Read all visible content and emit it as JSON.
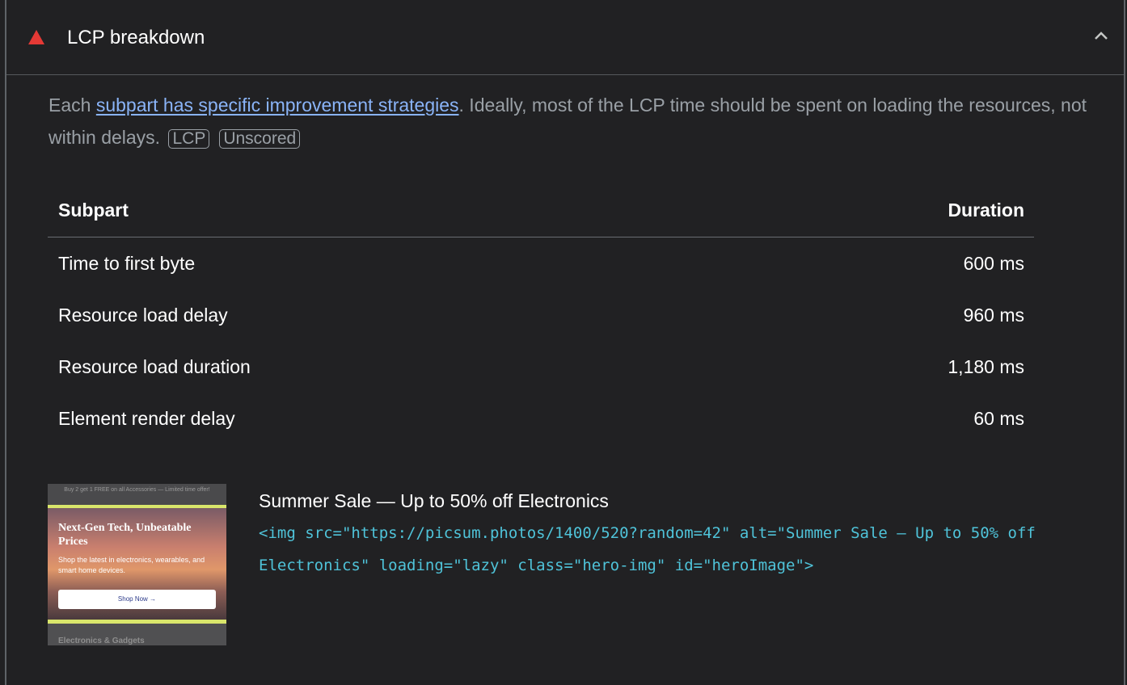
{
  "header": {
    "title": "LCP breakdown",
    "icon": "warning-triangle-icon",
    "chevron_icon": "chevron-up-icon",
    "warning_color": "#e53935"
  },
  "description": {
    "prefix": "Each ",
    "link_text": "subpart has specific improvement strategies",
    "suffix": ". Ideally, most of the LCP time should be spent on loading the resources, not within delays.",
    "badges": [
      "LCP",
      "Unscored"
    ]
  },
  "table": {
    "headers": {
      "subpart": "Subpart",
      "duration": "Duration"
    },
    "rows": [
      {
        "subpart": "Time to first byte",
        "duration": "600 ms"
      },
      {
        "subpart": "Resource load delay",
        "duration": "960 ms"
      },
      {
        "subpart": "Resource load duration",
        "duration": "1,180 ms"
      },
      {
        "subpart": "Element render delay",
        "duration": "60 ms"
      }
    ]
  },
  "element": {
    "title": "Summer Sale — Up to 50% off Electronics",
    "snippet": "<img src=\"https://picsum.photos/1400/520?random=42\" alt=\"Summer Sale – Up to 50% off Electronics\" loading=\"lazy\" class=\"hero-img\" id=\"heroImage\">",
    "thumbnail": {
      "banner": "Buy 2 get 1 FREE on all Accessories — Limited time offer!",
      "heading": "Next-Gen Tech, Unbeatable Prices",
      "subheading": "Shop the latest in electronics, wearables, and smart home devices.",
      "button": "Shop Now →",
      "section": "Electronics & Gadgets"
    }
  }
}
